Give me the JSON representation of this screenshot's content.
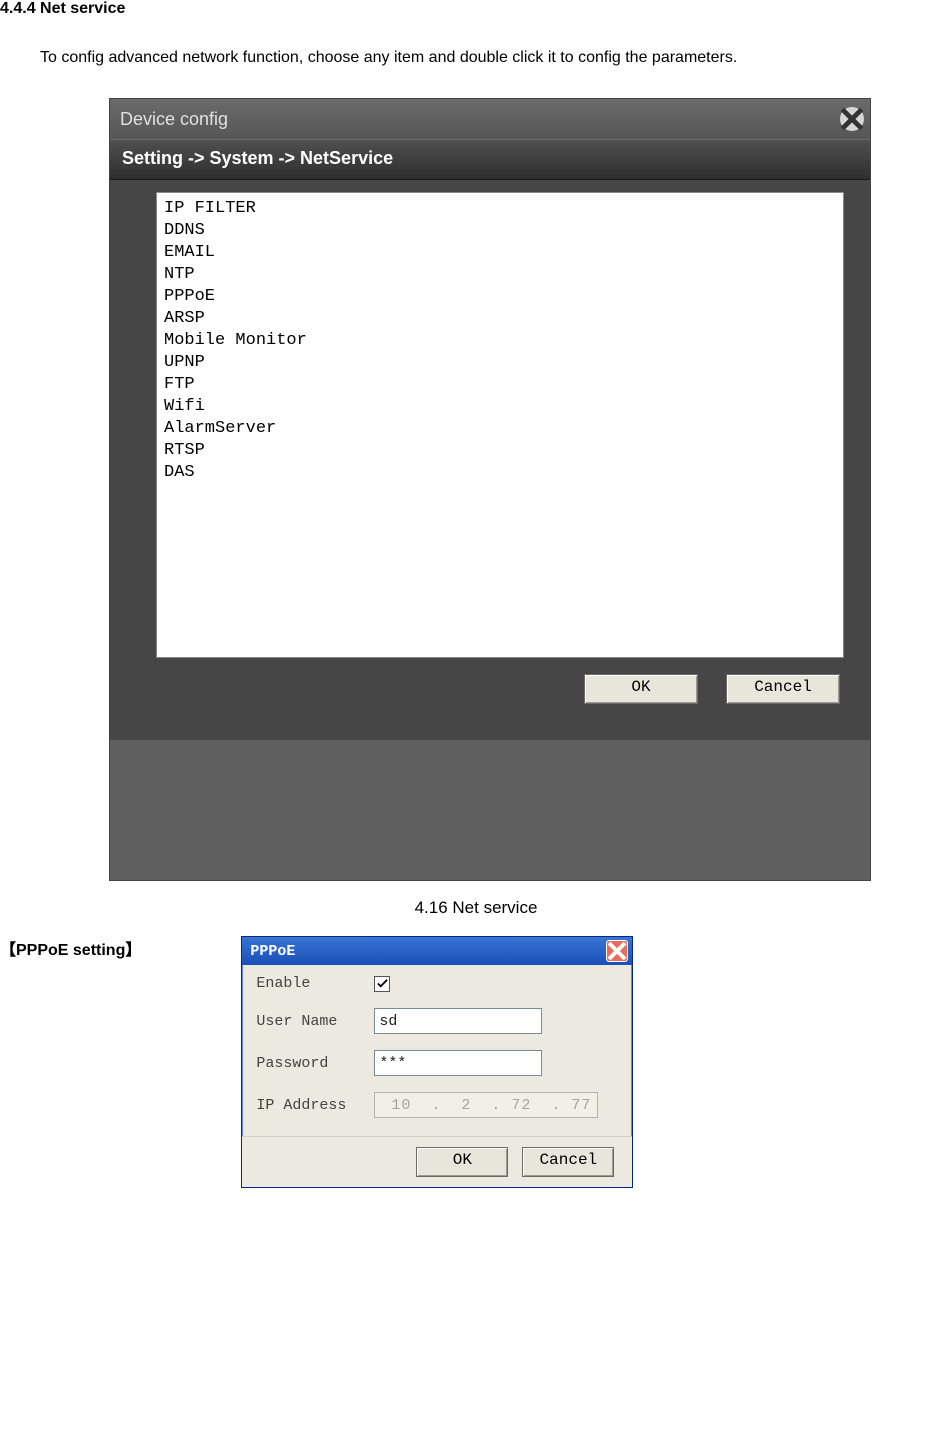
{
  "doc": {
    "section_heading": "4.4.4 Net service",
    "intro": "To config advanced network function, choose any item and double click it to config the parameters.",
    "fig_caption": "4.16 Net service",
    "pppoe_section_label": "【PPPoE setting】"
  },
  "dc": {
    "title": "Device config",
    "breadcrumb": "Setting -> System -> NetService",
    "items": [
      "IP FILTER",
      "DDNS",
      "EMAIL",
      "NTP",
      "PPPoE",
      "ARSP",
      "Mobile Monitor",
      "UPNP",
      "FTP",
      "Wifi",
      "AlarmServer",
      "RTSP",
      "DAS"
    ],
    "ok_label": "OK",
    "cancel_label": "Cancel"
  },
  "pppoe": {
    "title": "PPPoE",
    "enable_label": "Enable",
    "enable_checked": true,
    "user_label": "User Name",
    "user_value": "sd",
    "password_label": "Password",
    "password_value": "***",
    "ip_label": "IP Address",
    "ip_value": " 10  .  2  . 72  . 77",
    "ok_label": "OK",
    "cancel_label": "Cancel"
  }
}
